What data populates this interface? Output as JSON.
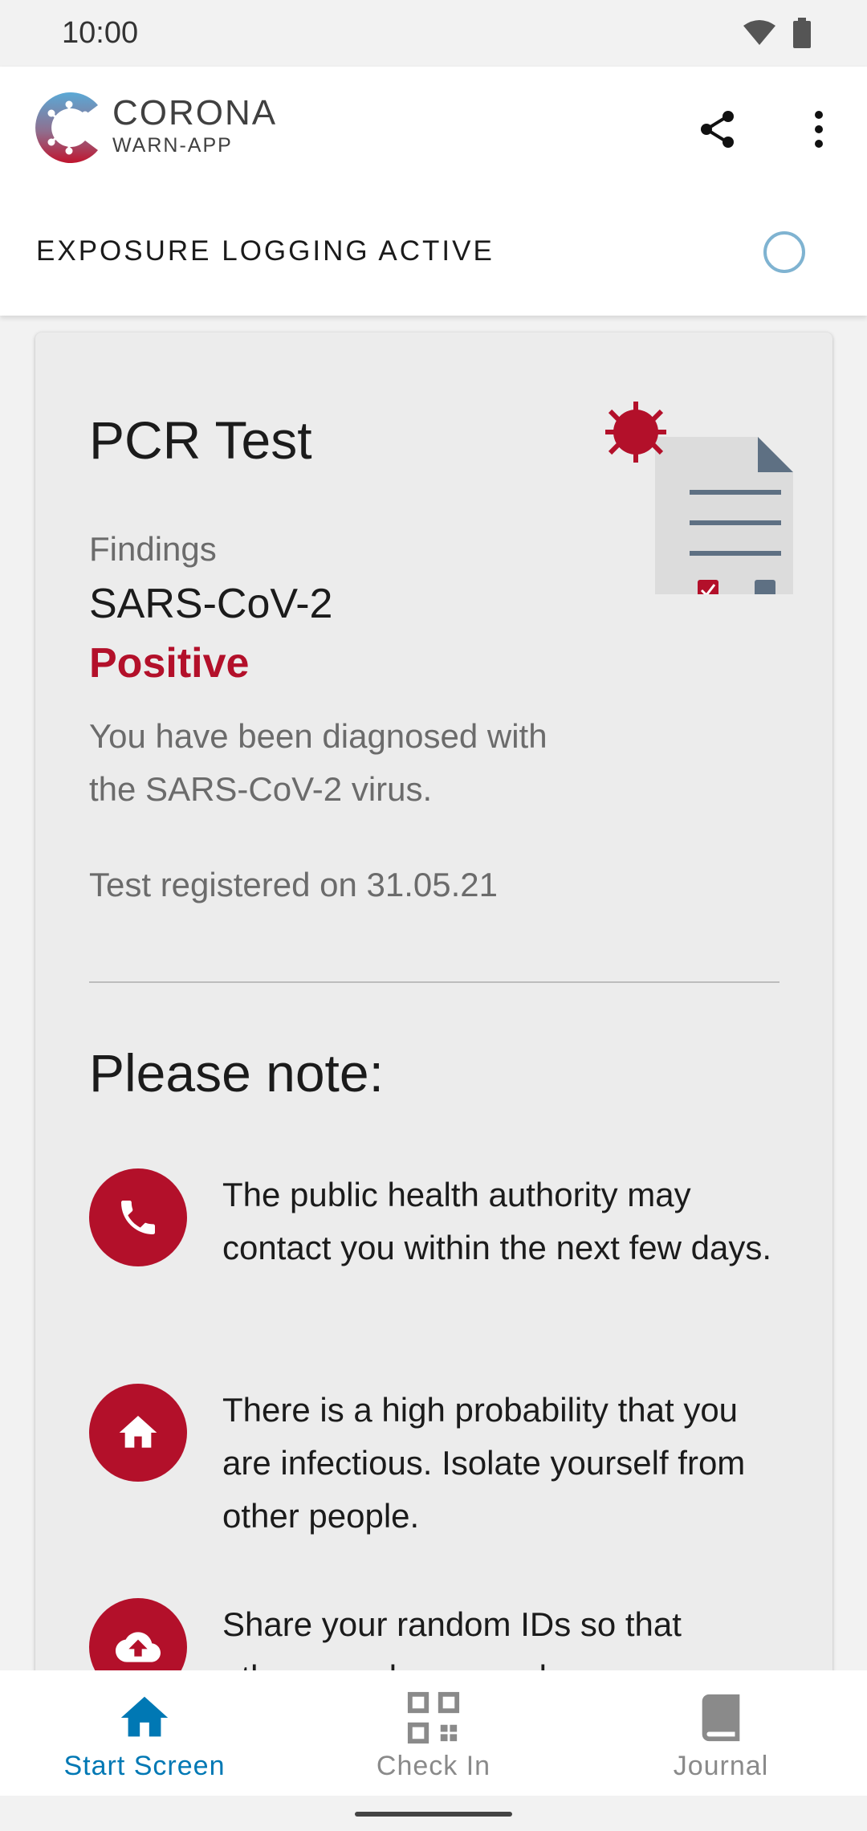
{
  "status_bar": {
    "time": "10:00",
    "icons": [
      "wifi-icon",
      "battery-icon"
    ]
  },
  "app_bar": {
    "brand_main": "CORONA",
    "brand_sub": "WARN-APP",
    "actions": [
      "share-icon",
      "more-options-icon"
    ],
    "exposure_status": "EXPOSURE LOGGING ACTIVE"
  },
  "test_card": {
    "title": "PCR Test",
    "findings_label": "Findings",
    "virus": "SARS-CoV-2",
    "result": "Positive",
    "description": "You have been diagnosed with the SARS-CoV-2 virus.",
    "registered": "Test registered on 31.05.21",
    "note_title": "Please note:",
    "notes": [
      {
        "icon": "phone-icon",
        "text": "The public health authority may contact you within the next few days."
      },
      {
        "icon": "home-icon",
        "text": "There is a high probability that you are infectious. Isolate yourself from other people."
      },
      {
        "icon": "cloud-upload-icon",
        "text": "Share your random IDs so that others can be warned."
      }
    ]
  },
  "bottom_nav": {
    "items": [
      {
        "label": "Start Screen",
        "icon": "home-icon",
        "active": true
      },
      {
        "label": "Check In",
        "icon": "qr-code-icon",
        "active": false
      },
      {
        "label": "Journal",
        "icon": "book-icon",
        "active": false
      }
    ]
  },
  "colors": {
    "accent_red": "#b3102a",
    "accent_blue": "#0078b4",
    "card_bg": "#ececec"
  }
}
